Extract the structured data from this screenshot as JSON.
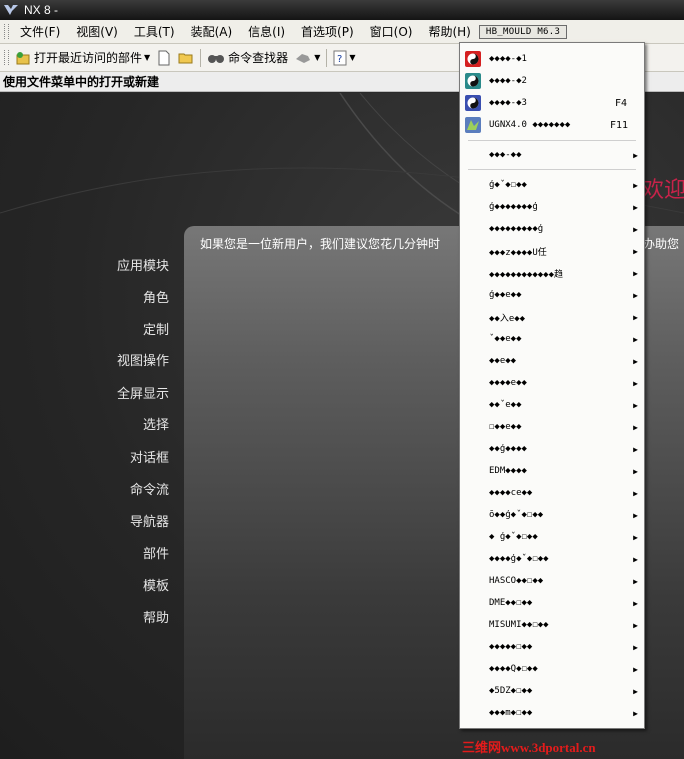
{
  "window": {
    "title": "NX 8 -"
  },
  "menubar": {
    "items": [
      "文件(F)",
      "视图(V)",
      "工具(T)",
      "装配(A)",
      "信息(I)",
      "首选项(P)",
      "窗口(O)",
      "帮助(H)"
    ],
    "active_item": "HB_MOULD M6.3"
  },
  "toolbar": {
    "open_recent_label": "打开最近访问的部件",
    "command_finder_label": "命令查找器"
  },
  "cue_line": "使用文件菜单中的打开或新建",
  "welcome": {
    "heading": "欢迎使",
    "intro_text": "如果您是一位新用户，我们建议您花几分钟时",
    "intro_suffix": "办助您",
    "nav_items": [
      "应用模块",
      "角色",
      "定制",
      "视图操作",
      "全屏显示",
      "选择",
      "对话框",
      "命令流",
      "导航器",
      "部件",
      "模板",
      "帮助"
    ]
  },
  "dropdown": {
    "items": [
      {
        "label": "◆◆◆◆-◆1",
        "icon": "yin-yang-red-icon",
        "color": "#d42020"
      },
      {
        "label": "◆◆◆◆-◆2",
        "icon": "yin-yang-teal-icon",
        "color": "#2a8a8a"
      },
      {
        "label": "◆◆◆◆-◆3",
        "icon": "yin-yang-blue-icon",
        "color": "#3a4fb0",
        "shortcut": "F4"
      },
      {
        "label": "UGNX4.0 ◆◆◆◆◆◆◆",
        "icon": "ugnx-icon",
        "color": "#5a7dbd",
        "shortcut": "F11"
      },
      {
        "label": "◆◆◆-◆◆",
        "submenu": true
      },
      {
        "label": "ģ◆ˇ◆☐◆◆",
        "submenu": true
      },
      {
        "label": "ģ◆◆◆◆◆◆◆ģ",
        "submenu": true
      },
      {
        "label": "◆◆◆◆◆◆◆◆◆ģ",
        "submenu": true
      },
      {
        "label": "◆◆◆z◆◆◆◆U任",
        "submenu": true
      },
      {
        "label": "◆◆◆◆◆◆◆◆◆◆◆◆趋",
        "submenu": true
      },
      {
        "label": "ģ◆◆e◆◆",
        "submenu": true
      },
      {
        "label": "◆◆入e◆◆",
        "submenu": true
      },
      {
        "label": "ˇ◆◆e◆◆",
        "submenu": true
      },
      {
        "label": "◆◆e◆◆",
        "submenu": true
      },
      {
        "label": "◆◆◆◆e◆◆",
        "submenu": true
      },
      {
        "label": "◆◆ˇe◆◆",
        "submenu": true
      },
      {
        "label": "☐◆◆e◆◆",
        "submenu": true
      },
      {
        "label": "◆◆ģ◆◆◆◆",
        "submenu": true
      },
      {
        "label": "EDM◆◆◆◆",
        "submenu": true
      },
      {
        "label": "◆◆◆◆ce◆◆",
        "submenu": true
      },
      {
        "label": "ō◆◆ģ◆ˇ◆☐◆◆",
        "submenu": true
      },
      {
        "label": "◆  ģ◆ˇ◆☐◆◆",
        "submenu": true
      },
      {
        "label": "◆◆◆◆ģ◆ˇ◆☐◆◆",
        "submenu": true
      },
      {
        "label": "HASCO◆◆☐◆◆",
        "submenu": true
      },
      {
        "label": "DME◆◆☐◆◆",
        "submenu": true
      },
      {
        "label": "MISUMI◆◆☐◆◆",
        "submenu": true
      },
      {
        "label": "◆◆◆◆◆☐◆◆",
        "submenu": true
      },
      {
        "label": "◆◆◆◆Q◆☐◆◆",
        "submenu": true
      },
      {
        "label": "◆5DZ◆☐◆◆",
        "submenu": true
      },
      {
        "label": "◆◆◆m◆☐◆◆",
        "submenu": true
      }
    ]
  },
  "watermark": "三维网www.3dportal.cn"
}
